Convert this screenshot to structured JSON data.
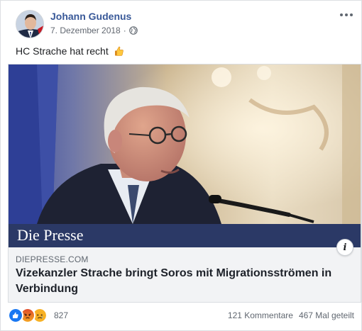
{
  "post": {
    "author": "Johann Gudenus",
    "date": "7. Dezember 2018",
    "date_separator": "·",
    "audience_icon": "globe-icon",
    "text": "HC Strache hat recht",
    "emoji": "thumbs-up-icon"
  },
  "link": {
    "brand": "Die Presse",
    "domain": "DIEPRESSE.COM",
    "title": "Vizekanzler Strache bringt Soros mit Migrationsströmen in Verbindung"
  },
  "footer": {
    "reaction_icons": [
      "like-icon",
      "angry-icon",
      "sad-icon"
    ],
    "reaction_count": "827",
    "comments": "121 Kommentare",
    "shares": "467 Mal geteilt"
  },
  "colors": {
    "author_link": "#385898",
    "brand_bar": "#2b3966",
    "like": "#1877f2",
    "angry": "#e9710f",
    "sad": "#f7b125"
  }
}
